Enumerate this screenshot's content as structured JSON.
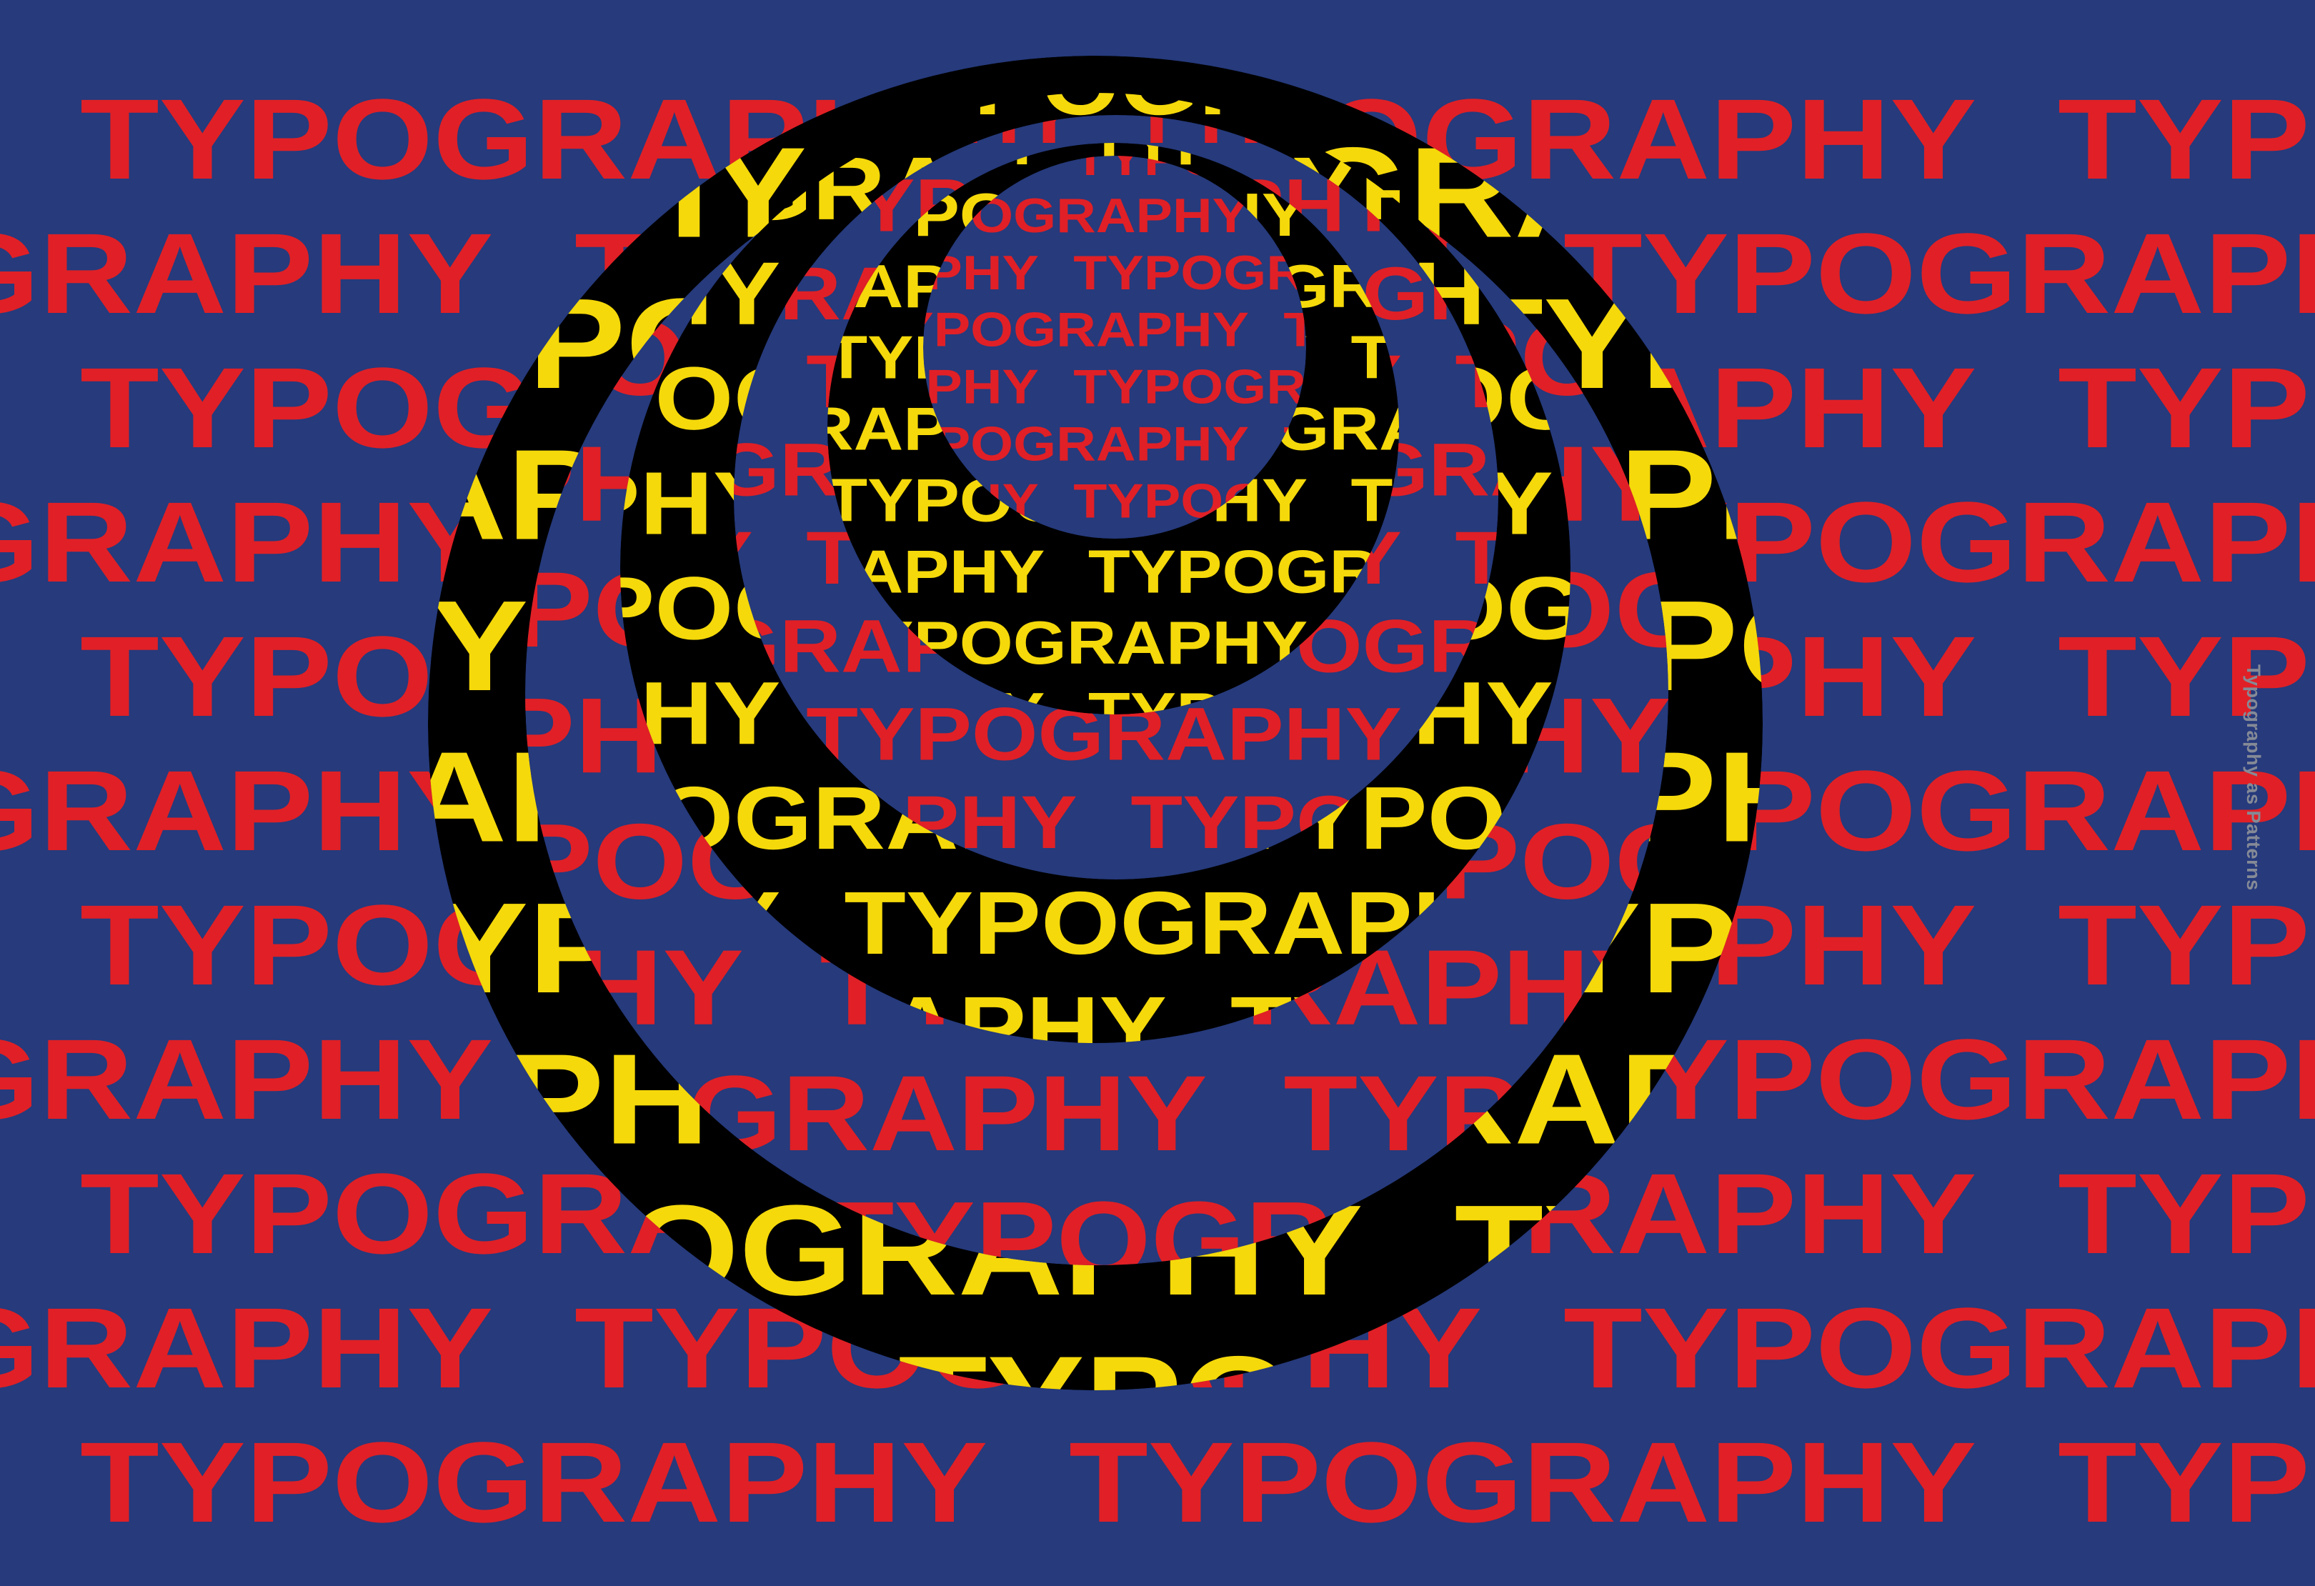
{
  "poster": {
    "word": "TYPOGRAPHY",
    "caption": "Typography as Patterns",
    "colors": {
      "background": "#263a7c",
      "pattern_red": "#e02026",
      "pattern_yellow": "#f5d90a",
      "ring_black": "#000000",
      "caption_gray": "#858a96"
    }
  }
}
